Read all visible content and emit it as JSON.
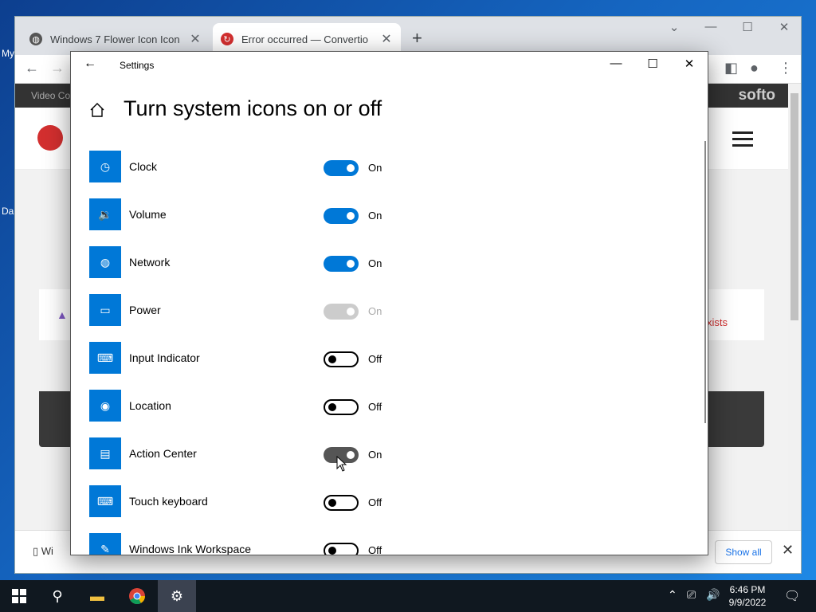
{
  "desktop": {
    "labels": [
      "My",
      "Da"
    ]
  },
  "browser": {
    "tabs": [
      {
        "title": "Windows 7 Flower Icon Icon",
        "icon": "globe-icon",
        "active": false
      },
      {
        "title": "Error occurred — Convertio",
        "icon": "convertio-icon",
        "active": true
      }
    ],
    "site": {
      "bar_text": "Video Co",
      "brand": "softo",
      "error_text": "xists"
    },
    "download": {
      "file": "Wi",
      "show_all": "Show all"
    }
  },
  "settings": {
    "app_title": "Settings",
    "heading": "Turn system icons on or off",
    "items": [
      {
        "label": "Clock",
        "state": "On",
        "icon": "clock-icon",
        "mode": "on"
      },
      {
        "label": "Volume",
        "state": "On",
        "icon": "volume-icon",
        "mode": "on"
      },
      {
        "label": "Network",
        "state": "On",
        "icon": "network-icon",
        "mode": "on"
      },
      {
        "label": "Power",
        "state": "On",
        "icon": "power-icon",
        "mode": "disabled"
      },
      {
        "label": "Input Indicator",
        "state": "Off",
        "icon": "keyboard-icon",
        "mode": "off"
      },
      {
        "label": "Location",
        "state": "Off",
        "icon": "location-icon",
        "mode": "off"
      },
      {
        "label": "Action Center",
        "state": "On",
        "icon": "action-center-icon",
        "mode": "hover"
      },
      {
        "label": "Touch keyboard",
        "state": "Off",
        "icon": "touch-keyboard-icon",
        "mode": "off"
      },
      {
        "label": "Windows Ink Workspace",
        "state": "Off",
        "icon": "pen-icon",
        "mode": "off"
      }
    ]
  },
  "taskbar": {
    "time": "6:46 PM",
    "date": "9/9/2022"
  },
  "colors": {
    "accent": "#0078d7",
    "taskbar": "#101820"
  }
}
